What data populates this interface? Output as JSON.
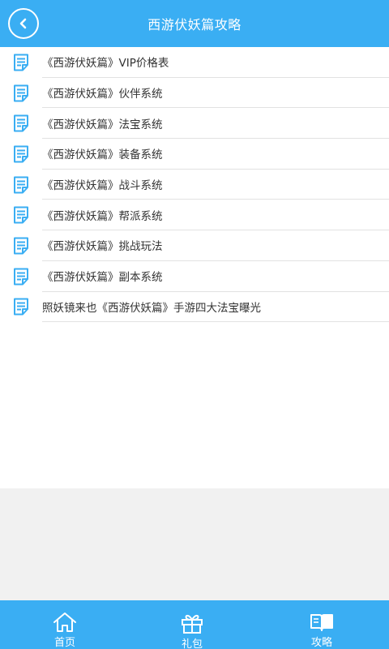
{
  "header": {
    "title": "西游伏妖篇攻略",
    "back_icon": "back-arrow-icon"
  },
  "articles": [
    {
      "title": "《西游伏妖篇》VIP价格表",
      "icon": "document-icon"
    },
    {
      "title": "《西游伏妖篇》伙伴系统",
      "icon": "document-icon"
    },
    {
      "title": "《西游伏妖篇》法宝系统",
      "icon": "document-icon"
    },
    {
      "title": "《西游伏妖篇》装备系统",
      "icon": "document-icon"
    },
    {
      "title": "《西游伏妖篇》战斗系统",
      "icon": "document-icon"
    },
    {
      "title": "《西游伏妖篇》帮派系统",
      "icon": "document-icon"
    },
    {
      "title": "《西游伏妖篇》挑战玩法",
      "icon": "document-icon"
    },
    {
      "title": "《西游伏妖篇》副本系统",
      "icon": "document-icon"
    },
    {
      "title": "照妖镜来也《西游伏妖篇》手游四大法宝曝光",
      "icon": "document-icon"
    }
  ],
  "bottom_nav": {
    "items": [
      {
        "label": "首页",
        "icon": "home-icon"
      },
      {
        "label": "礼包",
        "icon": "gift-icon"
      },
      {
        "label": "攻略",
        "icon": "book-icon"
      }
    ]
  },
  "colors": {
    "primary": "#3aaef3",
    "icon": "#3aaef3",
    "text": "#333333",
    "background": "#f1f1f1"
  }
}
